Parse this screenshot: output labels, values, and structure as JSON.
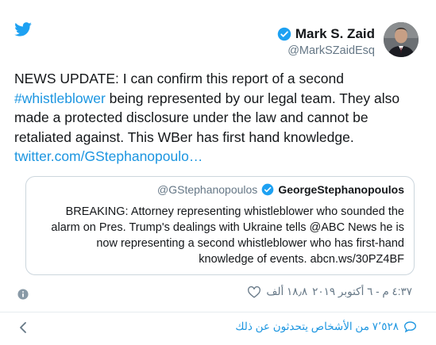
{
  "tweet": {
    "author_name": "Mark S. Zaid",
    "author_handle": "@MarkSZaidEsq",
    "text_part1": "NEWS UPDATE: I can confirm this report of a second ",
    "hashtag": "#whistleblower",
    "text_part2": " being represented by our legal team. They also made a protected disclosure under the law and cannot be retaliated against. This WBer has first hand knowledge. ",
    "link": "twitter.com/GStephanopoulo…"
  },
  "quoted_tweet": {
    "author_name": "GeorgeStephanopoulos",
    "author_handle": "@GStephanopoulos",
    "text": "BREAKING: Attorney representing whistleblower who sounded the alarm on Pres. Trump's dealings with Ukraine tells @ABC News he is now representing a second whistleblower who has first-hand knowledge of events. abcn.ws/30PZ4BF"
  },
  "meta": {
    "likes": "١٨٫٨ ألف",
    "timestamp": "٤:٣٧ م - ٦ أكتوبر ٢٠١٩"
  },
  "footer": {
    "replies_text": "٧٬٥٢٨ من الأشخاص يتحدثون عن ذلك"
  },
  "colors": {
    "twitter_blue": "#1da1f2",
    "link_blue": "#1b95e0",
    "muted_gray": "#657786",
    "border_gray": "#ccd6dd"
  },
  "icons": {
    "logo": "twitter-bird-icon",
    "verified": "verified-badge-icon",
    "info": "info-icon",
    "like": "heart-icon",
    "back": "chevron-left-icon",
    "conversation": "speech-bubble-icon"
  }
}
